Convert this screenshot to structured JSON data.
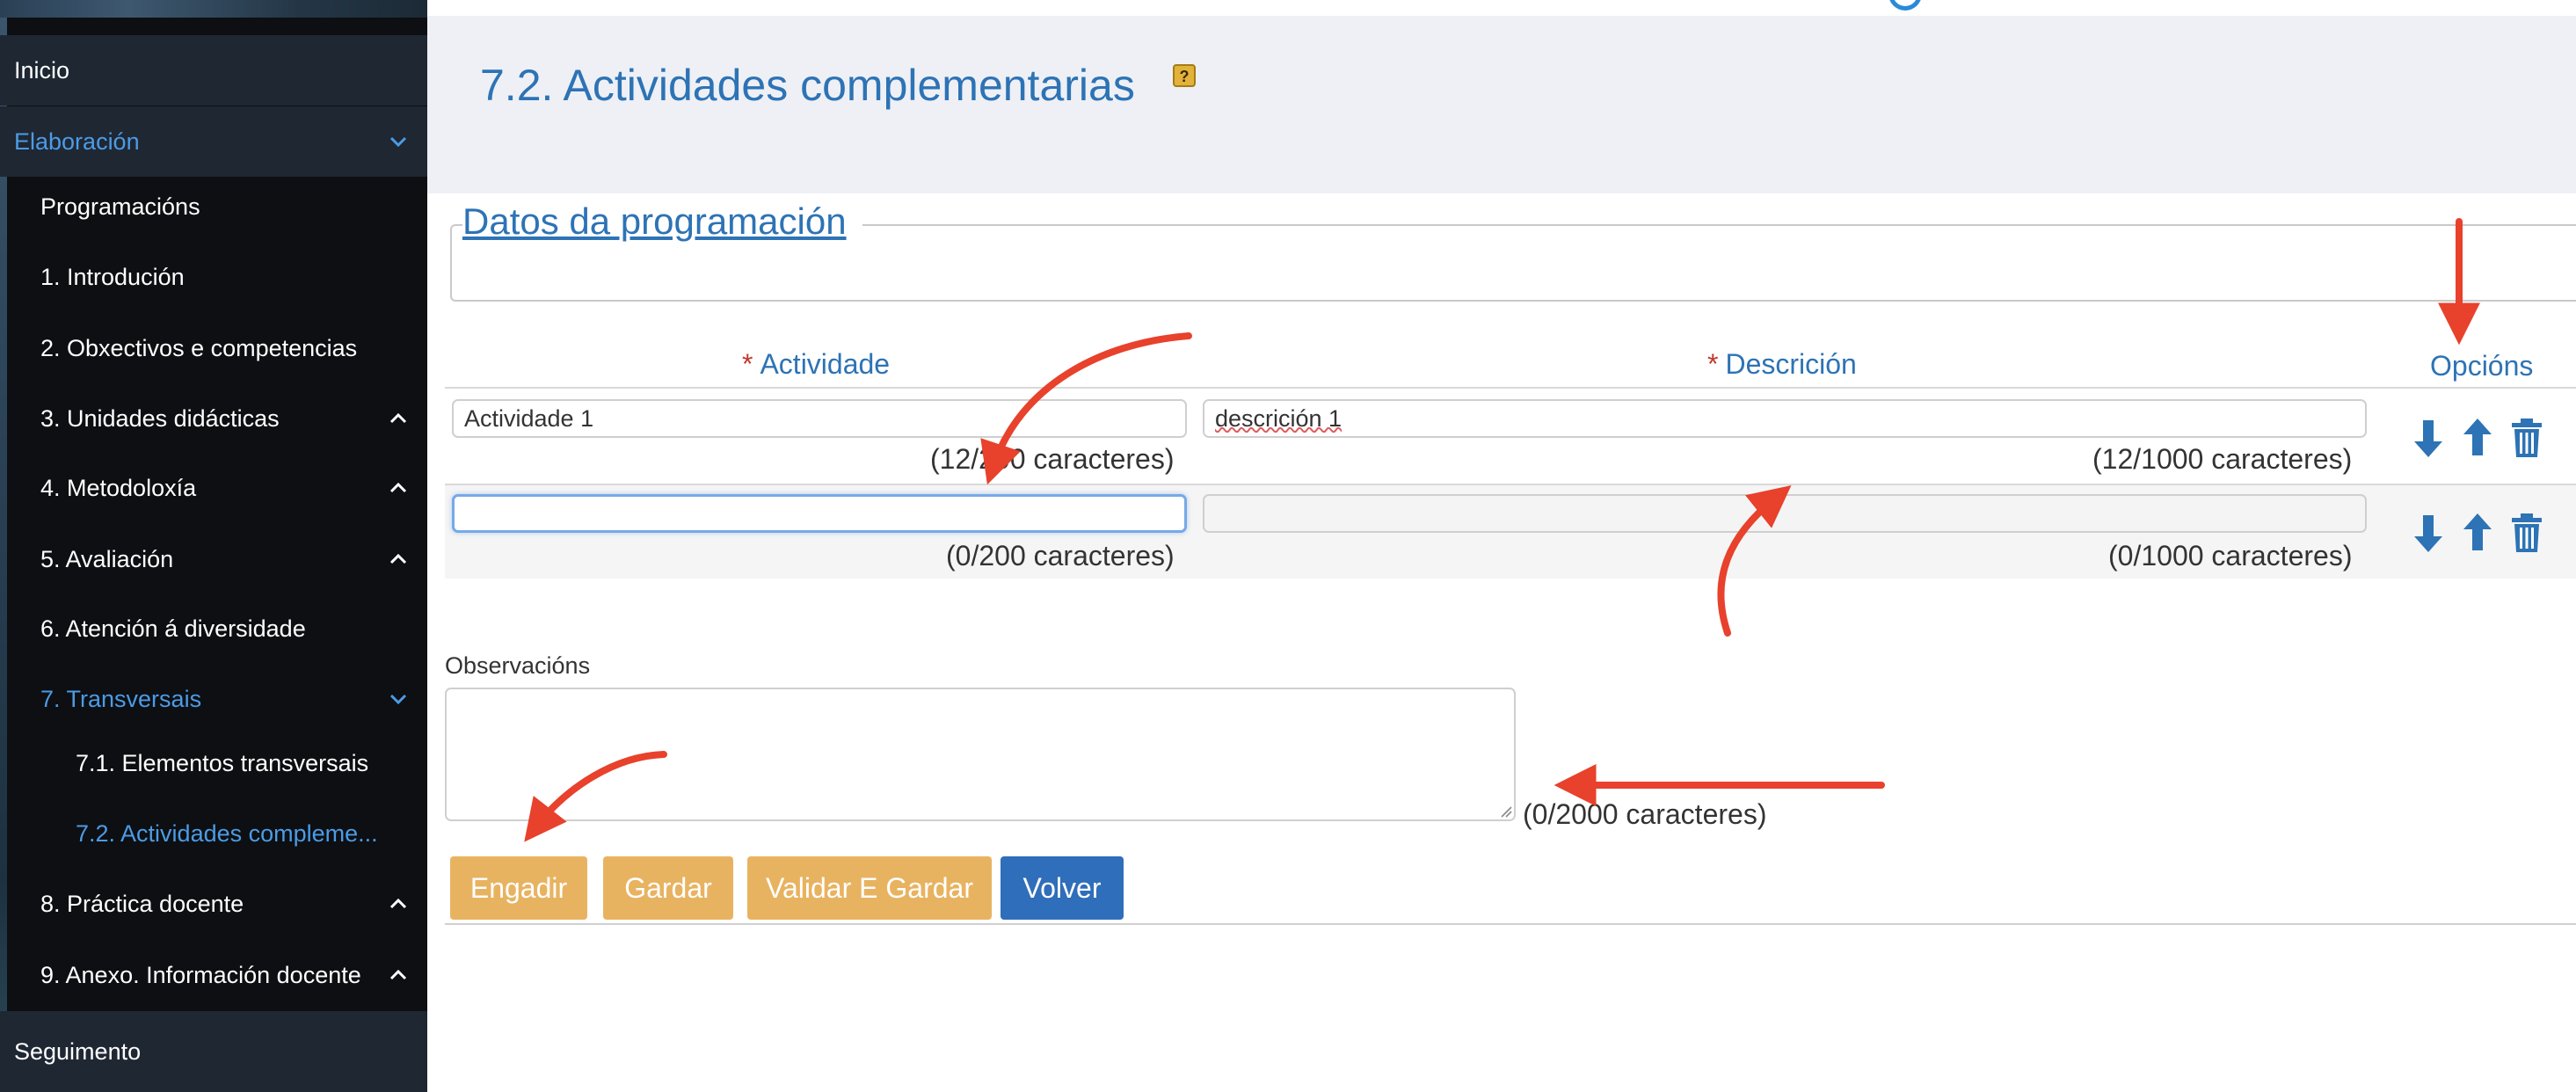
{
  "sidebar": {
    "items": [
      {
        "label": "Inicio",
        "level": 0,
        "active": false,
        "chevron": ""
      },
      {
        "label": "Elaboración",
        "level": 0,
        "active": true,
        "chevron": "down"
      },
      {
        "label": "Programacións",
        "level": 1,
        "active": false,
        "chevron": ""
      },
      {
        "label": "1. Introdución",
        "level": 1,
        "active": false,
        "chevron": ""
      },
      {
        "label": "2. Obxectivos e competencias",
        "level": 1,
        "active": false,
        "chevron": ""
      },
      {
        "label": "3. Unidades didácticas",
        "level": 1,
        "active": false,
        "chevron": "up"
      },
      {
        "label": "4. Metodoloxía",
        "level": 1,
        "active": false,
        "chevron": "up"
      },
      {
        "label": "5. Avaliación",
        "level": 1,
        "active": false,
        "chevron": "up"
      },
      {
        "label": "6. Atención á diversidade",
        "level": 1,
        "active": false,
        "chevron": ""
      },
      {
        "label": "7. Transversais",
        "level": 1,
        "active": true,
        "chevron": "down"
      },
      {
        "label": "7.1. Elementos transversais",
        "level": 2,
        "active": false,
        "chevron": ""
      },
      {
        "label": "7.2. Actividades compleme...",
        "level": 2,
        "active": true,
        "chevron": ""
      },
      {
        "label": "8. Práctica docente",
        "level": 1,
        "active": false,
        "chevron": "up"
      },
      {
        "label": "9. Anexo. Información docente",
        "level": 1,
        "active": false,
        "chevron": "up"
      },
      {
        "label": "Seguimento",
        "level": 0,
        "active": false,
        "chevron": ""
      }
    ]
  },
  "header": {
    "title": "7.2. Actividades complementarias",
    "help_icon": "?"
  },
  "section": {
    "legend": "Datos da programación"
  },
  "table": {
    "required_mark": "*",
    "col_activity": "Actividade",
    "col_description": "Descrición",
    "col_options": "Opcións",
    "rows": [
      {
        "activity": "Actividade 1",
        "description": "descrición 1",
        "activity_counter": "(12/200 caracteres)",
        "description_counter": "(12/1000 caracteres)"
      },
      {
        "activity": "",
        "description": "",
        "activity_counter": "(0/200 caracteres)",
        "description_counter": "(0/1000 caracteres)"
      }
    ],
    "option_icons": [
      "arrow-down-icon",
      "arrow-up-icon",
      "trash-icon"
    ]
  },
  "observations": {
    "label": "Observacións",
    "value": "",
    "counter": "(0/2000 caracteres)"
  },
  "buttons": {
    "add": "Engadir",
    "save": "Gardar",
    "validate_save": "Validar E Gardar",
    "back": "Volver"
  },
  "colors": {
    "accent_blue": "#2d73b5",
    "button_orange": "#e8b360",
    "button_blue": "#2f6eba",
    "annotation_red": "#e8412c",
    "sidebar_bg": "#0d0f12",
    "sidebar_active": "#4c9be6"
  }
}
